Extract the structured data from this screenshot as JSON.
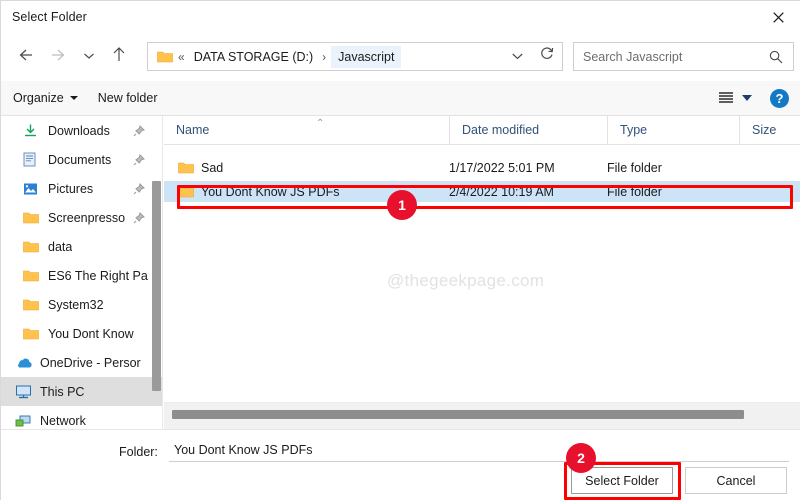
{
  "window": {
    "title": "Select Folder",
    "close_icon": "close-icon"
  },
  "nav": {
    "back_icon": "arrow-left-icon",
    "forward_icon": "arrow-right-icon",
    "recent_icon": "chevron-down-icon",
    "up_icon": "arrow-up-icon"
  },
  "address": {
    "folder_icon": "folder-icon",
    "separator_first": "«",
    "crumbs": [
      {
        "label": "DATA STORAGE (D:)",
        "active": false
      },
      {
        "label": "Javascript",
        "active": true
      }
    ],
    "separator": "›",
    "dropdown_icon": "chevron-down-icon",
    "refresh_icon": "refresh-icon"
  },
  "search": {
    "placeholder": "Search Javascript",
    "value": "",
    "icon": "search-icon"
  },
  "commandbar": {
    "organize_label": "Organize",
    "new_folder_label": "New folder",
    "view_icon": "view-list-icon",
    "view_caret_icon": "chevron-down-icon",
    "help_label": "?",
    "help_icon": "help-icon"
  },
  "sidebar": {
    "items": [
      {
        "label": "Downloads",
        "icon": "downloads-icon",
        "pinned": true,
        "selected": false
      },
      {
        "label": "Documents",
        "icon": "documents-icon",
        "pinned": true,
        "selected": false
      },
      {
        "label": "Pictures",
        "icon": "pictures-icon",
        "pinned": true,
        "selected": false
      },
      {
        "label": "Screenpresso",
        "icon": "folder-icon",
        "pinned": true,
        "selected": false
      },
      {
        "label": "data",
        "icon": "folder-icon",
        "pinned": false,
        "selected": false
      },
      {
        "label": "ES6 The Right Pa",
        "icon": "folder-icon",
        "pinned": false,
        "selected": false
      },
      {
        "label": "System32",
        "icon": "folder-icon",
        "pinned": false,
        "selected": false
      },
      {
        "label": "You Dont Know",
        "icon": "folder-icon",
        "pinned": false,
        "selected": false
      },
      {
        "label": "OneDrive - Persor",
        "icon": "onedrive-icon",
        "pinned": false,
        "selected": false
      },
      {
        "label": "This PC",
        "icon": "this-pc-icon",
        "pinned": false,
        "selected": true
      },
      {
        "label": "Network",
        "icon": "network-icon",
        "pinned": false,
        "selected": false
      }
    ]
  },
  "filelist": {
    "columns": [
      {
        "label": "Name",
        "sorted": "asc"
      },
      {
        "label": "Date modified",
        "sorted": ""
      },
      {
        "label": "Type",
        "sorted": ""
      },
      {
        "label": "Size",
        "sorted": ""
      }
    ],
    "sort_indicator": "⌃",
    "rows": [
      {
        "name": "Sad",
        "date_modified": "1/17/2022 5:01 PM",
        "type": "File folder",
        "size": "",
        "selected": false,
        "icon": "folder-icon"
      },
      {
        "name": "You Dont Know JS PDFs",
        "date_modified": "2/4/2022 10:19 AM",
        "type": "File folder",
        "size": "",
        "selected": true,
        "icon": "folder-icon"
      }
    ]
  },
  "watermark": "@thegeekpage.com",
  "footer": {
    "folder_label": "Folder:",
    "folder_value": "You Dont Know JS PDFs",
    "select_button": "Select Folder",
    "cancel_button": "Cancel"
  },
  "annotations": {
    "badge_1": "1",
    "badge_2": "2",
    "highlight_color": "#ff0000",
    "badge_color": "#e8112d"
  }
}
